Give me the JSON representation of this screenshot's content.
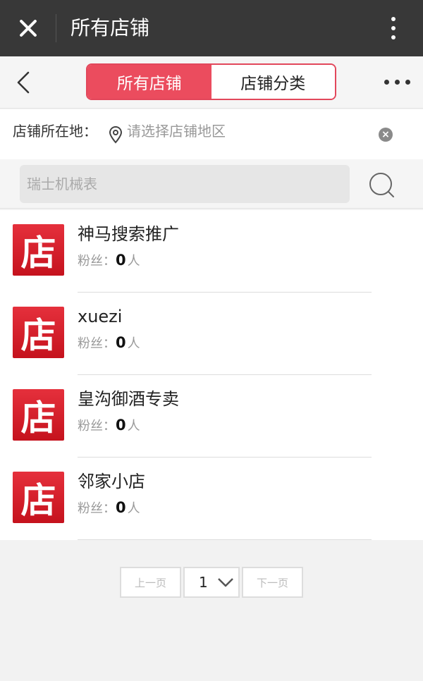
{
  "header": {
    "title": "所有店铺"
  },
  "nav": {
    "tabs": [
      {
        "label": "所有店铺",
        "active": true
      },
      {
        "label": "店铺分类",
        "active": false
      }
    ]
  },
  "location": {
    "label": "店铺所在地：",
    "placeholder": "请选择店铺地区"
  },
  "search": {
    "placeholder": "瑞士机械表"
  },
  "stores": [
    {
      "logo": "店",
      "name": "神马搜索推广",
      "fans_label": "粉丝：",
      "fans": "0",
      "unit": "人"
    },
    {
      "logo": "店",
      "name": "xuezi",
      "fans_label": "粉丝：",
      "fans": "0",
      "unit": "人"
    },
    {
      "logo": "店",
      "name": "皇沟御酒专卖",
      "fans_label": "粉丝：",
      "fans": "0",
      "unit": "人"
    },
    {
      "logo": "店",
      "name": "邻家小店",
      "fans_label": "粉丝：",
      "fans": "0",
      "unit": "人"
    }
  ],
  "pagination": {
    "prev": "上一页",
    "page": "1",
    "next": "下一页"
  },
  "colors": {
    "accent": "#eb4c5e",
    "titlebar": "#383838",
    "logo": "#d9222e"
  }
}
